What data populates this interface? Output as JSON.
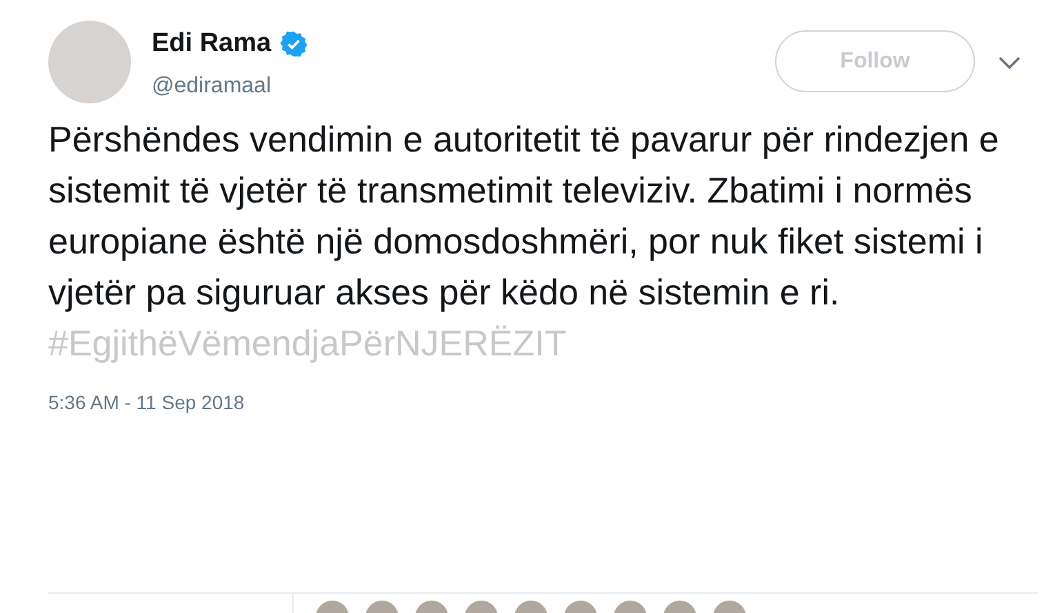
{
  "author": {
    "name": "Edi Rama",
    "verified": true,
    "handle": "@ediramaal"
  },
  "follow_button": {
    "label": "Follow"
  },
  "tweet": {
    "text": "Përshëndes vendimin e autoritetit të pavarur për rindezjen e sistemit të vjetër të transmetimit televiziv. Zbatimi i normës europiane është një domosdoshmëri, por nuk fiket sistemi i vjetër pa siguruar akses për këdo në sistemin e ri.",
    "hashtag": "#EgjithëVëmendjaPërNJERËZIT",
    "timestamp": "5:36 AM - 11 Sep 2018"
  }
}
